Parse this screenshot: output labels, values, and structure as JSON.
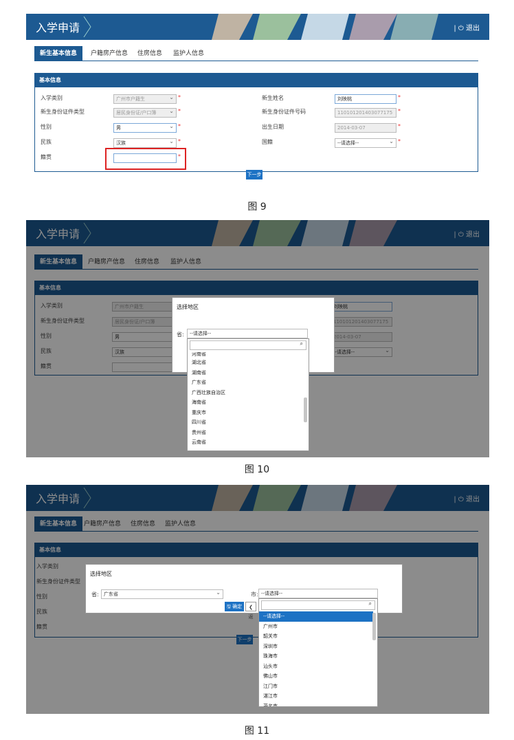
{
  "colors": {
    "header": "#1d5a92",
    "accent": "#1d72c4",
    "required": "#e33333",
    "highlight": "#d22222"
  },
  "app": {
    "title": "入学申请",
    "logout": "| ⏻ 退出"
  },
  "tabs": [
    "新生基本信息",
    "户籍房产信息",
    "住房信息",
    "监护人信息"
  ],
  "section_title": "基本信息",
  "form": {
    "labels": {
      "admission_type": "入学类别",
      "id_type": "新生身份证件类型",
      "gender": "性别",
      "ethnicity": "民族",
      "native_place": "籍贯",
      "name": "新生姓名",
      "id_number": "新生身份证件号码",
      "birthdate": "出生日期",
      "nationality": "国籍"
    },
    "values": {
      "admission_type": "广州市户籍生",
      "id_type": "居民身份证/户口簿",
      "gender": "男",
      "ethnicity": "汉族",
      "native_place": "",
      "name": "刘映桃",
      "id_number": "110101201403077175",
      "birthdate": "2014-03-07",
      "nationality": "--请选择--"
    },
    "required_mark": "*",
    "next_button": "下一步"
  },
  "captions": [
    "图 9",
    "图 10",
    "图 11"
  ],
  "dialog": {
    "title": "选择地区",
    "province_label": "省:",
    "city_label": "市:",
    "placeholder": "--请选择--",
    "province_selected": "广东省",
    "province_options": [
      "河南省",
      "湖北省",
      "湖南省",
      "广东省",
      "广西壮族自治区",
      "海南省",
      "重庆市",
      "四川省",
      "贵州省",
      "云南省"
    ],
    "city_options": [
      "--请选择--",
      "广州市",
      "韶关市",
      "深圳市",
      "珠海市",
      "汕头市",
      "佛山市",
      "江门市",
      "湛江市",
      "茂名市"
    ],
    "confirm_button": "🖫 确定",
    "back_button": "❮ 返"
  }
}
